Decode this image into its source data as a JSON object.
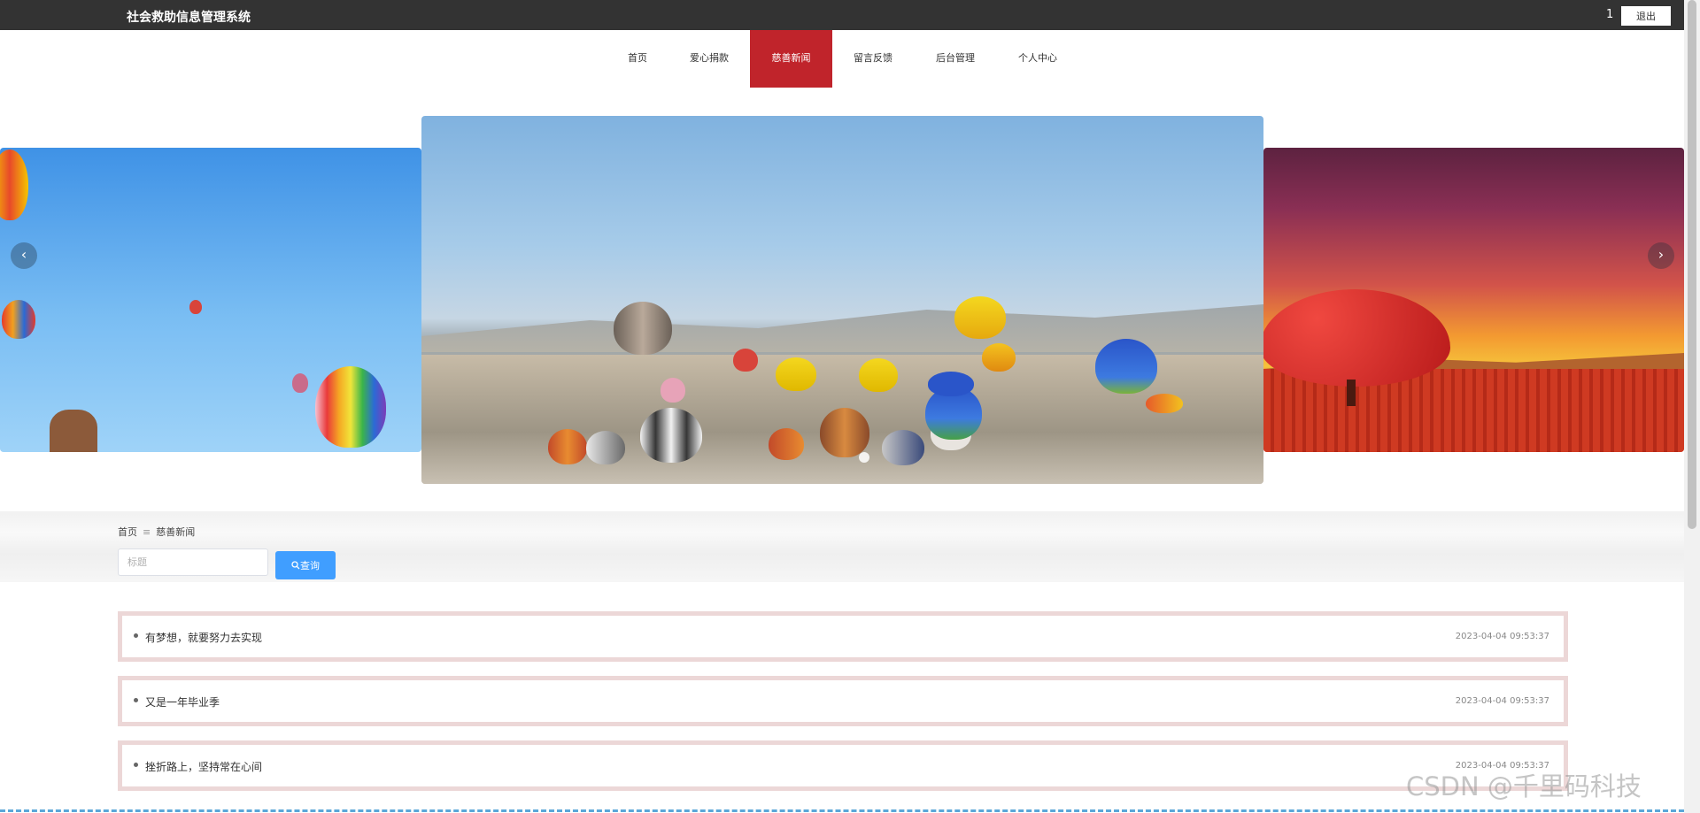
{
  "header": {
    "system_title": "社会救助信息管理系统",
    "user_name": "1",
    "logout_label": "退出"
  },
  "nav": {
    "items": [
      {
        "label": "首页"
      },
      {
        "label": "爱心捐款"
      },
      {
        "label": "慈善新闻"
      },
      {
        "label": "留言反馈"
      },
      {
        "label": "后台管理"
      },
      {
        "label": "个人中心"
      }
    ],
    "active": "慈善新闻"
  },
  "carousel": {
    "prev_icon": "chevron-left-icon",
    "next_icon": "chevron-right-icon",
    "prev_glyph": "‹",
    "next_glyph": "›"
  },
  "breadcrumb": {
    "home": "首页",
    "separator": "≡",
    "current": "慈善新闻"
  },
  "search": {
    "placeholder": "标题",
    "value": "",
    "button_label": "查询",
    "button_icon": "search-icon",
    "button_color": "#409eff"
  },
  "news": [
    {
      "title": "有梦想，就要努力去实现",
      "time": "2023-04-04 09:53:37"
    },
    {
      "title": "又是一年毕业季",
      "time": "2023-04-04 09:53:37"
    },
    {
      "title": "挫折路上，坚持常在心间",
      "time": "2023-04-04 09:53:37"
    }
  ],
  "watermark": "CSDN @千里码科技",
  "colors": {
    "topbar": "#333333",
    "nav_active": "#c0242b",
    "item_border": "#ecd7d7"
  }
}
